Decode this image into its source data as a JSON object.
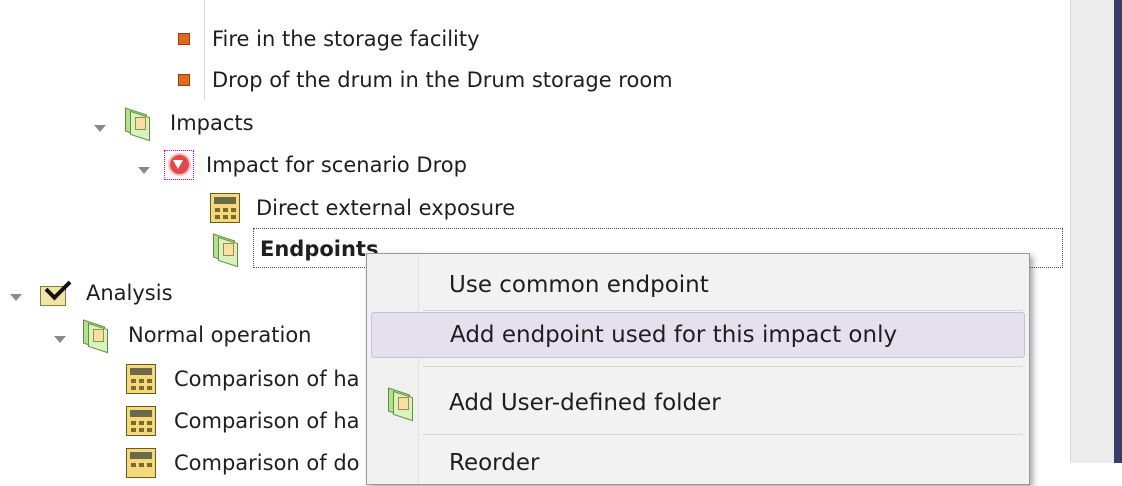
{
  "tree": {
    "items": [
      {
        "label": "Fire in the storage facility",
        "icon": "orange-square-icon"
      },
      {
        "label": "Drop of the drum in the Drum storage room",
        "icon": "orange-square-icon"
      },
      {
        "label": "Impacts",
        "icon": "folder-icon",
        "expanded": true
      },
      {
        "label": "Impact for scenario Drop",
        "icon": "impact-icon",
        "expanded": true
      },
      {
        "label": "Direct external exposure",
        "icon": "calculator-icon"
      },
      {
        "label": "Endpoints",
        "icon": "folder-icon",
        "selected": true
      },
      {
        "label": "Analysis",
        "icon": "analysis-check-icon",
        "expanded": true
      },
      {
        "label": "Normal operation",
        "icon": "folder-icon",
        "expanded": true
      },
      {
        "label": "Comparison of ha",
        "icon": "calculator-icon"
      },
      {
        "label": "Comparison of ha",
        "icon": "calculator-icon"
      },
      {
        "label": "Comparison of do",
        "icon": "calculator-icon"
      }
    ]
  },
  "context_menu": {
    "items": [
      {
        "label": "Use common endpoint",
        "icon": ""
      },
      {
        "label": "Add endpoint used for this impact only",
        "icon": "",
        "highlighted": true
      },
      {
        "label": "Add User-defined folder",
        "icon": "folder-icon"
      },
      {
        "label": "Reorder",
        "icon": ""
      }
    ]
  },
  "colors": {
    "menu_highlight": "#e4e0ee",
    "bullet": "#e26a1c",
    "scroll_edge": "#3a3c66"
  }
}
